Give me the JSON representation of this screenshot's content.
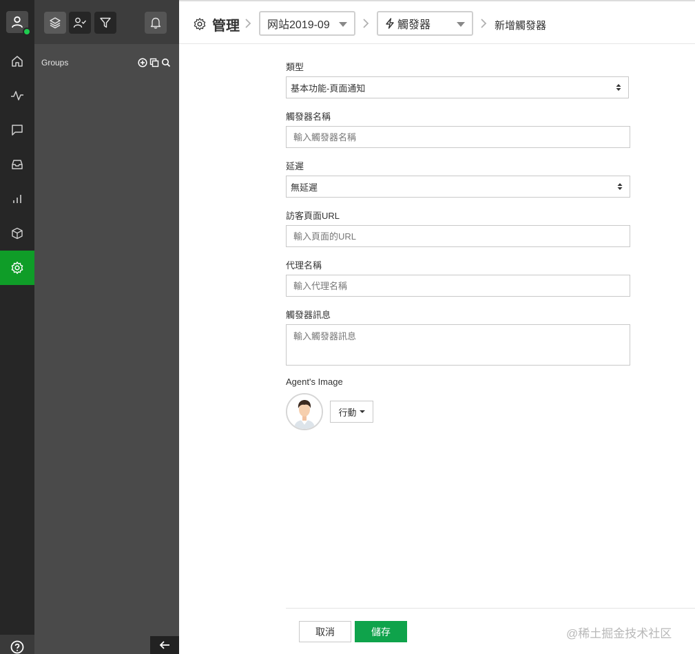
{
  "rail": {
    "items": [
      {
        "name": "home",
        "icon": "home-icon"
      },
      {
        "name": "activity",
        "icon": "activity-icon"
      },
      {
        "name": "chat",
        "icon": "chat-icon"
      },
      {
        "name": "inbox",
        "icon": "inbox-icon"
      },
      {
        "name": "reports",
        "icon": "bar-chart-icon"
      },
      {
        "name": "apps",
        "icon": "box-icon"
      },
      {
        "name": "settings",
        "icon": "gear-icon",
        "active": true
      }
    ],
    "status_color": "#1ecb4f",
    "active_color": "#0f9d28"
  },
  "panel": {
    "groups_label": "Groups"
  },
  "header": {
    "title": "管理",
    "website_select": "网站2019-09",
    "trigger_select": "觸發器",
    "current": "新增觸發器"
  },
  "form": {
    "type_label": "類型",
    "type_value": "基本功能-頁面通知",
    "name_label": "觸發器名稱",
    "name_placeholder": "輸入觸發器名稱",
    "delay_label": "延遲",
    "delay_value": "無延遲",
    "url_label": "訪客頁面URL",
    "url_placeholder": "輸入頁面的URL",
    "agent_name_label": "代理名稱",
    "agent_name_placeholder": "輸入代理名稱",
    "message_label": "觸發器訊息",
    "message_placeholder": "輸入觸發器訊息",
    "agent_image_label": "Agent's Image",
    "action_label": "行動"
  },
  "footer": {
    "cancel_label": "取消",
    "save_label": "儲存",
    "save_color": "#0fa34b"
  },
  "watermark": "@稀土掘金技术社区"
}
